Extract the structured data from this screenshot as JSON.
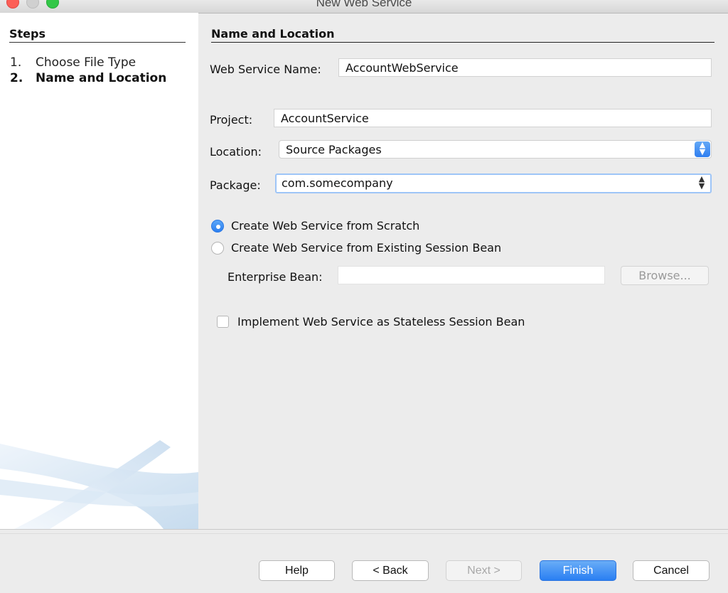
{
  "window": {
    "title": "New Web Service"
  },
  "steps": {
    "heading": "Steps",
    "items": [
      {
        "num": "1.",
        "label": "Choose File Type"
      },
      {
        "num": "2.",
        "label": "Name and Location"
      }
    ]
  },
  "section": {
    "heading": "Name and Location"
  },
  "form": {
    "web_service_name_label": "Web Service Name:",
    "web_service_name_value": "AccountWebService",
    "project_label": "Project:",
    "project_value": "AccountService",
    "location_label": "Location:",
    "location_value": "Source Packages",
    "package_label": "Package:",
    "package_value": "com.somecompany",
    "radio_scratch_label": "Create Web Service from Scratch",
    "radio_scratch_selected": true,
    "radio_bean_label": "Create Web Service from Existing Session Bean",
    "enterprise_bean_label": "Enterprise Bean:",
    "enterprise_bean_value": "",
    "browse_label": "Browse...",
    "stateless_label": "Implement Web Service as Stateless Session Bean",
    "stateless_checked": false
  },
  "buttons": {
    "help": "Help",
    "back": "< Back",
    "next": "Next >",
    "finish": "Finish",
    "cancel": "Cancel"
  },
  "icons": {
    "close": "close-icon",
    "minimize": "minimize-icon",
    "zoom": "zoom-icon",
    "stepper": "stepper-icon"
  },
  "colors": {
    "accent": "#2f7ef0",
    "close": "#fc5f57",
    "zoom": "#33c748"
  }
}
